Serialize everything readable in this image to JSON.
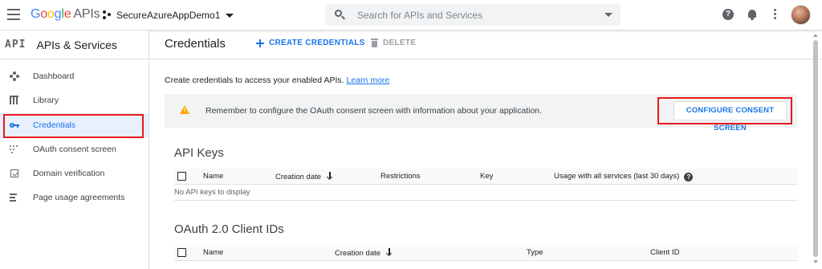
{
  "header": {
    "logo": {
      "g1": "G",
      "g2": "o",
      "g3": "o",
      "g4": "g",
      "g5": "l",
      "g6": "e",
      "apis": "APIs"
    },
    "project_name": "SecureAzureAppDemo1",
    "search_placeholder": "Search for APIs and Services",
    "help_glyph": "?"
  },
  "sidebar": {
    "logo_text": "API",
    "title": "APIs & Services",
    "items": [
      {
        "label": "Dashboard",
        "icon": "dashboard-icon"
      },
      {
        "label": "Library",
        "icon": "library-icon"
      },
      {
        "label": "Credentials",
        "icon": "key-icon",
        "active": true
      },
      {
        "label": "OAuth consent screen",
        "icon": "consent-dots-icon"
      },
      {
        "label": "Domain verification",
        "icon": "checkbox-icon"
      },
      {
        "label": "Page usage agreements",
        "icon": "settings-list-icon"
      }
    ]
  },
  "main": {
    "title": "Credentials",
    "create_label": "CREATE CREDENTIALS",
    "delete_label": "DELETE",
    "intro_text": "Create credentials to access your enabled APIs.",
    "learn_more": "Learn more",
    "banner_text": "Remember to configure the OAuth consent screen with information about your application.",
    "banner_glyph": "!",
    "consent_button": "CONFIGURE CONSENT SCREEN",
    "api_keys": {
      "title": "API Keys",
      "columns": [
        "Name",
        "Creation date",
        "Restrictions",
        "Key",
        "Usage with all services (last 30 days)"
      ],
      "empty": "No API keys to display"
    },
    "oauth": {
      "title": "OAuth 2.0 Client IDs",
      "columns": [
        "Name",
        "Creation date",
        "Type",
        "Client ID"
      ]
    }
  },
  "colors": {
    "accent": "#1a73e8",
    "highlight": "#e8191c",
    "warning": "#f9ab00"
  }
}
